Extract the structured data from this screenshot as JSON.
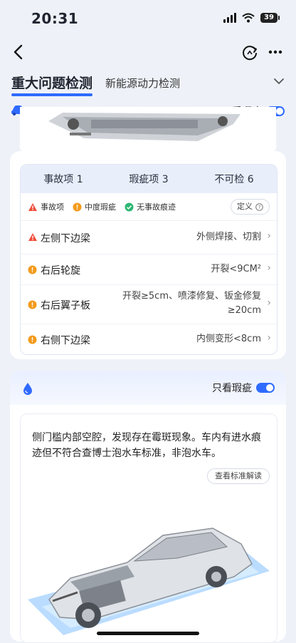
{
  "status": {
    "time": "20:31",
    "battery": "39"
  },
  "tabs": {
    "active": "重大问题检测",
    "second": "新能源动力检测"
  },
  "section1": {
    "filter_label": "只看瑕疵"
  },
  "table": {
    "headers": [
      "事故项 1",
      "瑕疵项 3",
      "不可检 6"
    ],
    "legend": {
      "accident": "事故项",
      "moderate": "中度瑕疵",
      "none": "无事故痕迹"
    },
    "define_label": "定义",
    "rows": [
      {
        "name": "左侧下边梁",
        "detail": "外侧焊接、切割",
        "level": "accident"
      },
      {
        "name": "右后轮旋",
        "detail": "开裂<9CM²",
        "level": "moderate"
      },
      {
        "name": "右后翼子板",
        "detail": "开裂≥5cm、喷漆修复、钣金修复≥20cm",
        "level": "moderate"
      },
      {
        "name": "右侧下边梁",
        "detail": "内侧变形<8cm",
        "level": "moderate"
      }
    ]
  },
  "section2": {
    "filter_label": "只看瑕疵",
    "description": "侧门槛内部空腔，发现存在霉斑现象。车内有进水痕迹但不符合查博士泡水车标准，非泡水车。",
    "std_button": "查看标准解读"
  },
  "colors": {
    "accent": "#2f6bff",
    "accident": "#f04d3a",
    "moderate": "#f39a1b",
    "none": "#2bb673"
  }
}
